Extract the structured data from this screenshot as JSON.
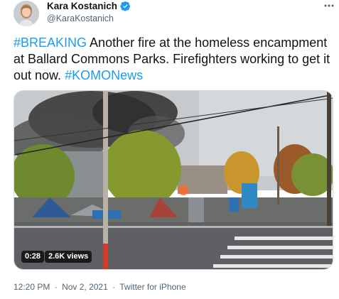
{
  "author": {
    "display_name": "Kara Kostanich",
    "handle": "@KaraKostanich",
    "verified": true,
    "avatar_icon": "profile-photo"
  },
  "more_icon": "more-dots-icon",
  "tweet": {
    "segments": [
      {
        "text": "#BREAKING",
        "type": "hashtag"
      },
      {
        "text": " Another fire at the homeless encampment at Ballard Commons Parks. Firefighters working to get it out now. ",
        "type": "text"
      },
      {
        "text": "#KOMONews",
        "type": "hashtag"
      }
    ]
  },
  "video": {
    "duration": "0:28",
    "views": "2.6K views"
  },
  "footer": {
    "time": "12:20 PM",
    "separator_1": "·",
    "date": "Nov 2, 2021",
    "separator_2": "·",
    "source": "Twitter for iPhone"
  },
  "colors": {
    "accent": "#1d9bf0",
    "secondary_text": "#536471",
    "primary_text": "#0f1419"
  }
}
